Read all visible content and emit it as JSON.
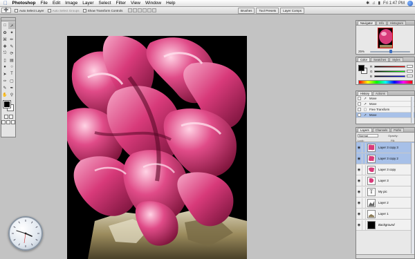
{
  "menubar": {
    "items": [
      "Photoshop",
      "File",
      "Edit",
      "Image",
      "Layer",
      "Select",
      "Filter",
      "View",
      "Window",
      "Help"
    ],
    "right": [
      "Fri 1:47 PM"
    ]
  },
  "options": {
    "auto_select_layer": "Auto Select Layer",
    "auto_select_groups": "Auto Select Groups",
    "show_transform": "Show Transform Controls",
    "well_tabs": [
      "Brushes",
      "Tool Presets",
      "Layer Comps"
    ]
  },
  "navigator": {
    "tabs": [
      "Navigator",
      "Info",
      "Histogram"
    ],
    "zoom": "25%"
  },
  "color": {
    "tabs": [
      "Color",
      "Swatches",
      "Styles"
    ],
    "channels": [
      "R",
      "G",
      "B"
    ]
  },
  "history": {
    "tabs": [
      "History",
      "Actions"
    ],
    "items": [
      "Move",
      "Move",
      "Free Transform",
      "Move"
    ],
    "selected_index": 3
  },
  "layers": {
    "tabs": [
      "Layers",
      "Channels",
      "Paths"
    ],
    "blend_mode": "Normal",
    "opacity_label": "Opacity:",
    "lock_label": "Lock:",
    "fill_label": "Fill:",
    "items": [
      {
        "name": "Layer 3 copy 3",
        "selected": true
      },
      {
        "name": "Layer 3 copy 2",
        "selected": true
      },
      {
        "name": "Layer 3 copy",
        "selected": false
      },
      {
        "name": "Layer 3",
        "selected": false
      },
      {
        "name": "My pic",
        "selected": false,
        "type": "text"
      },
      {
        "name": "Layer 2",
        "selected": false
      },
      {
        "name": "Layer 1",
        "selected": false
      },
      {
        "name": "Background",
        "selected": false
      }
    ]
  },
  "colors": {
    "accent": "#3d6fc1",
    "artwork_pink": "#d83a7a",
    "selection": "#a7c0e8"
  }
}
